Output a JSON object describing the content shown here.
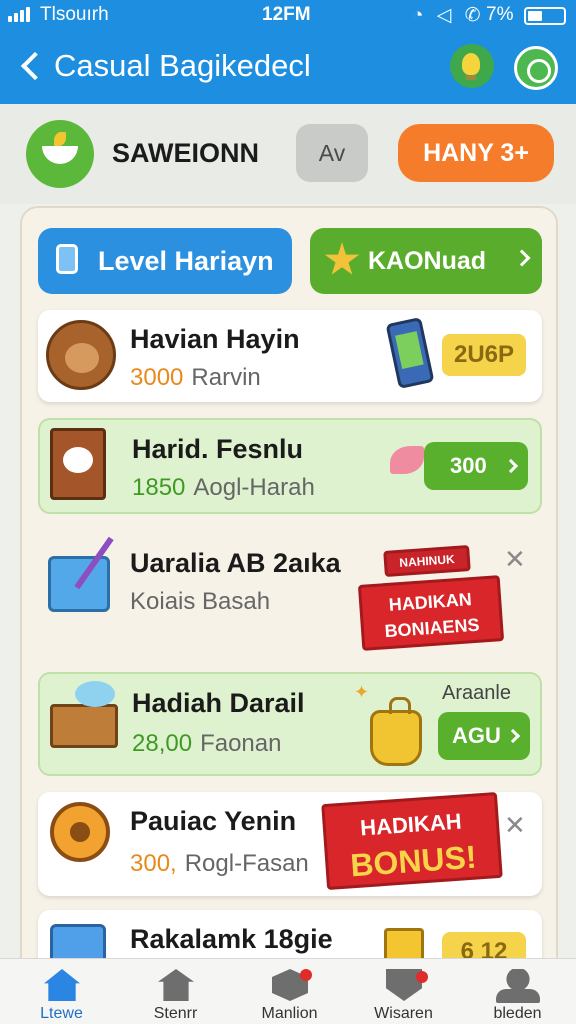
{
  "status_bar": {
    "carrier": "Tlsouırh",
    "time": "12FM",
    "icons": "◔ ◁ ✆",
    "battery": "7%"
  },
  "app_bar": {
    "title": "Casual Bagikedecl"
  },
  "header": {
    "player_name": "SAWEIONN",
    "av_label": "Av",
    "many_label": "HANY 3+"
  },
  "tabs": [
    {
      "label": "Level Hariayn"
    },
    {
      "label": "KAONuad"
    }
  ],
  "rows": [
    {
      "title": "Havian Hayin",
      "value": "3000",
      "desc": "Rarvin",
      "badge": "2U6P"
    },
    {
      "title": "Harid. Fesnlu",
      "value": "1850",
      "desc": "Aogl-Harah",
      "button": "300"
    },
    {
      "title": "Uaralia AB 2aıka",
      "desc": "Koiais Basah",
      "banner_top": "NAHINUK",
      "banner_line1": "HADIKAN",
      "banner_line2": "BONIAENS"
    },
    {
      "title": "Hadiah Darail",
      "value": "28,00",
      "desc": "Faonan",
      "tag": "Araanle",
      "button": "AGU"
    },
    {
      "title": "Pauiac Yenin",
      "value": "300,",
      "desc": "Rogl-Fasan",
      "banner_line1": "HADIKAH",
      "banner_line2": "BONUS!"
    },
    {
      "title": "Rakalamk 18gie",
      "badge": "6 12"
    }
  ],
  "bottom_nav": [
    {
      "label": "Ltewe",
      "icon": "home-icon"
    },
    {
      "label": "Stenrr",
      "icon": "store-icon"
    },
    {
      "label": "Manlion",
      "icon": "mission-icon"
    },
    {
      "label": "Wisaren",
      "icon": "rewards-icon"
    },
    {
      "label": "bleden",
      "icon": "profile-icon"
    }
  ],
  "colors": {
    "top_bar": "#1e8fe0",
    "accent_green": "#58b02c",
    "accent_orange": "#f57c2a",
    "bonus_red": "#d8262a"
  }
}
